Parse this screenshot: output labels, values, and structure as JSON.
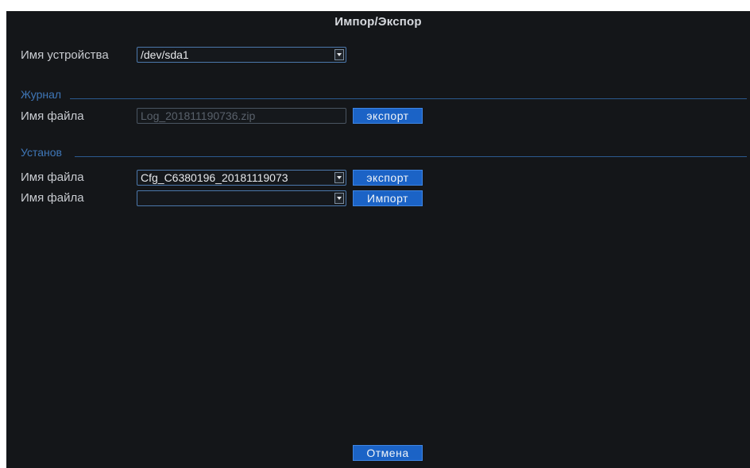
{
  "dialog": {
    "title": "Импор/Экспор"
  },
  "device": {
    "label": "Имя устройства",
    "value": "/dev/sda1"
  },
  "journal": {
    "section_label": "Журнал",
    "file_label": "Имя файла",
    "file_value": "Log_201811190736.zip",
    "export_label": "экспорт"
  },
  "settings": {
    "section_label": "Установ",
    "export_file_label": "Имя файла",
    "export_file_value": "Cfg_C6380196_20181119073",
    "export_label": "экспорт",
    "import_file_label": "Имя файла",
    "import_file_value": "",
    "import_label": "Импорт"
  },
  "footer": {
    "cancel_label": "Отмена"
  },
  "colors": {
    "background": "#141619",
    "accent": "#1b63c6",
    "section": "#3f77b8"
  }
}
